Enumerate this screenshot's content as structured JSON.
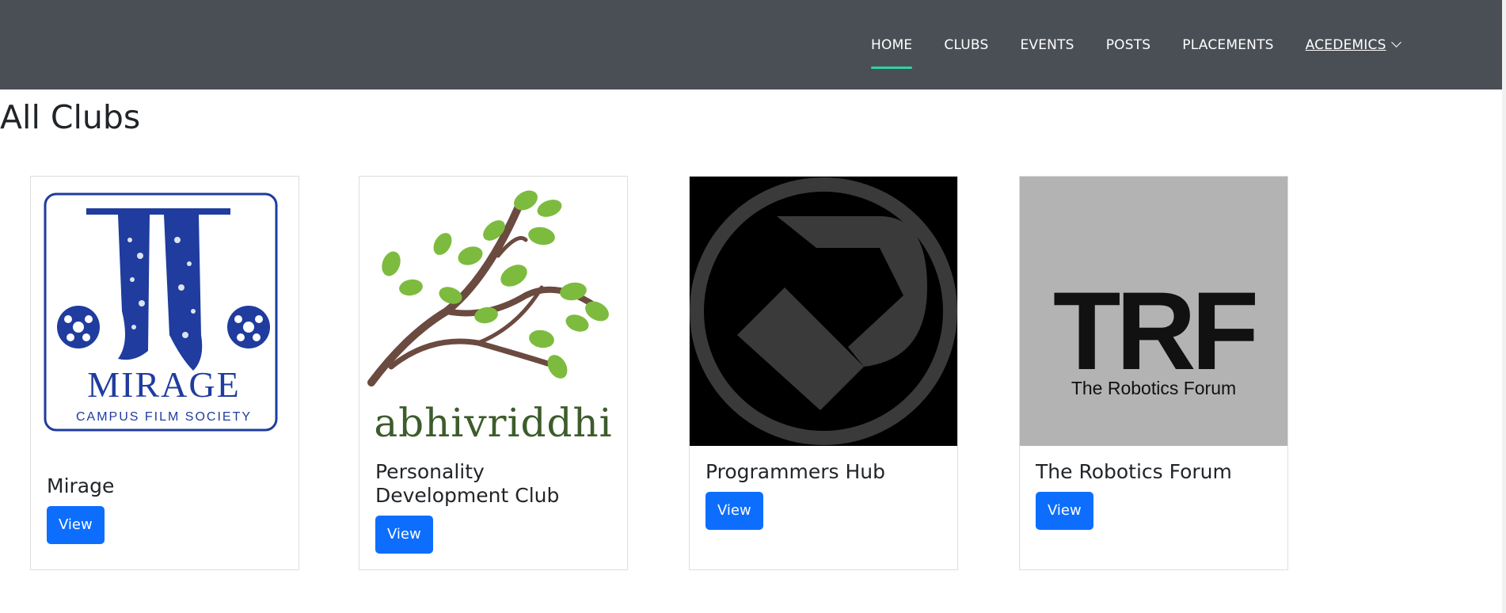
{
  "nav": {
    "items": [
      {
        "label": "HOME",
        "active": true
      },
      {
        "label": "CLUBS"
      },
      {
        "label": "EVENTS"
      },
      {
        "label": "POSTS"
      },
      {
        "label": "PLACEMENTS"
      },
      {
        "label": "ACEDEMICS",
        "dropdown": true
      }
    ]
  },
  "page": {
    "title": "All Clubs"
  },
  "clubs": [
    {
      "name": "Mirage",
      "button": "View",
      "logo": {
        "wordmark": "MIRAGE",
        "subtitle": "CAMPUS FILM SOCIETY"
      }
    },
    {
      "name": "Personality Development Club",
      "name_line1": "Personality",
      "name_line2": "Development Club",
      "button": "View",
      "logo": {
        "wordmark": "abhivriddhi"
      }
    },
    {
      "name": "Programmers Hub",
      "button": "View",
      "logo": {}
    },
    {
      "name": "The Robotics Forum",
      "button": "View",
      "logo": {
        "wordmark": "TRF",
        "subtitle": "The Robotics Forum"
      }
    }
  ],
  "colors": {
    "header_bg": "#4a4f55",
    "active_underline": "#2fd4a0",
    "button_bg": "#0d6efd",
    "mirage_blue": "#1f3c9e",
    "leaf_green": "#7dbb3f",
    "branch_brown": "#6b4a40",
    "abhi_text": "#3d5c2c"
  }
}
